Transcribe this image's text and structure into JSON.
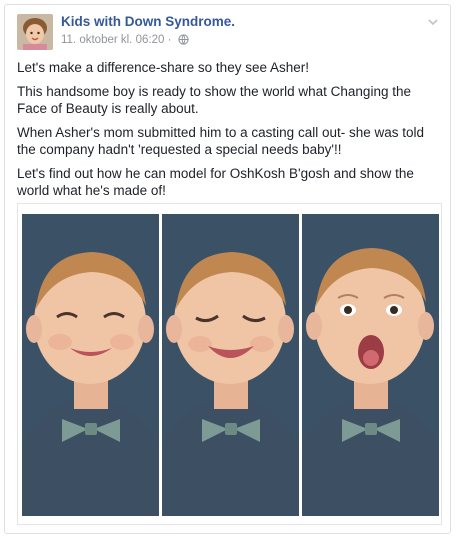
{
  "post": {
    "author": "Kids with Down Syndrome.",
    "timestamp": "11. oktober kl. 06:20",
    "separator": "·",
    "icons": {
      "privacy": "globe-icon",
      "menu": "chevron-down-icon"
    },
    "paragraphs": [
      "Let's make a difference-share so they see Asher!",
      "This handsome boy is ready to show the world what Changing the Face of Beauty is really about.",
      "When Asher's mom submitted him to a casting call out- she was told the company hadn't 'requested a special needs baby'!!",
      "Let's find out how he can model for OshKosh B'gosh and show the world what he's made of!"
    ],
    "photos": [
      {
        "expression": "smile"
      },
      {
        "expression": "laugh"
      },
      {
        "expression": "surprise"
      }
    ]
  },
  "colors": {
    "link": "#365899",
    "meta": "#90949c",
    "text": "#1d2129",
    "backdrop": "#3b5166"
  }
}
